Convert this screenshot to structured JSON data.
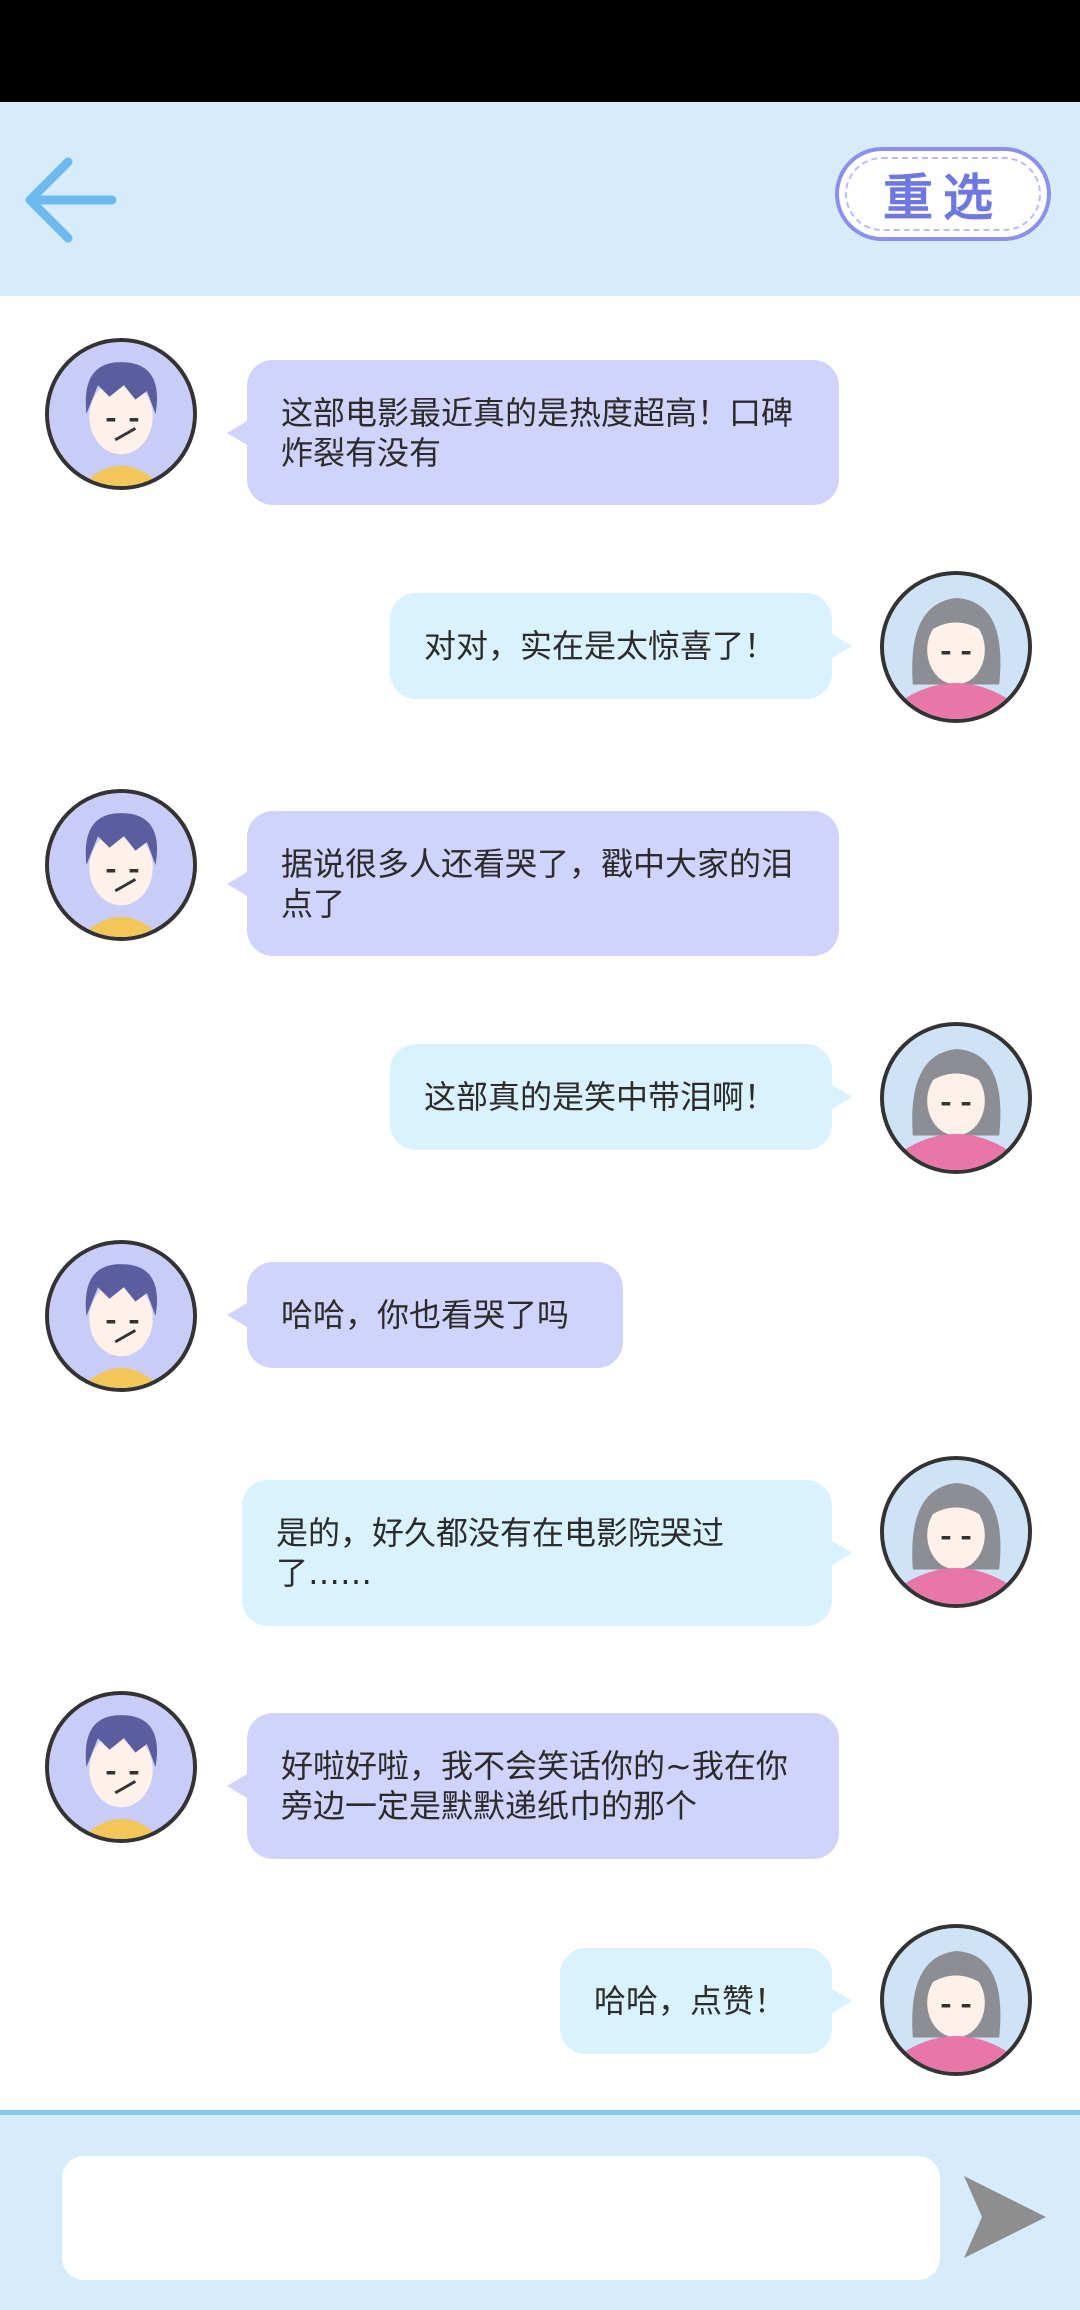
{
  "header": {
    "reselect_label": "重选"
  },
  "messages": [
    {
      "side": "left",
      "text": "这部电影最近真的是热度超高！口碑炸裂有没有"
    },
    {
      "side": "right",
      "text": "对对，实在是太惊喜了！"
    },
    {
      "side": "left",
      "text": "据说很多人还看哭了，戳中大家的泪点了"
    },
    {
      "side": "right",
      "text": "这部真的是笑中带泪啊！"
    },
    {
      "side": "left",
      "text": "哈哈，你也看哭了吗"
    },
    {
      "side": "right",
      "text": "是的，好久都没有在电影院哭过了……"
    },
    {
      "side": "left",
      "text": "好啦好啦，我不会笑话你的~我在你旁边一定是默默递纸巾的那个"
    },
    {
      "side": "right",
      "text": "哈哈，点赞！"
    }
  ],
  "input": {
    "value": "",
    "placeholder": ""
  },
  "icons": {
    "back": "back-arrow-icon",
    "send": "send-icon"
  },
  "colors": {
    "header_bg": "#d7ecfb",
    "left_bubble": "#d0d3fb",
    "right_bubble": "#d9f2fd",
    "accent": "#6f77e0"
  }
}
